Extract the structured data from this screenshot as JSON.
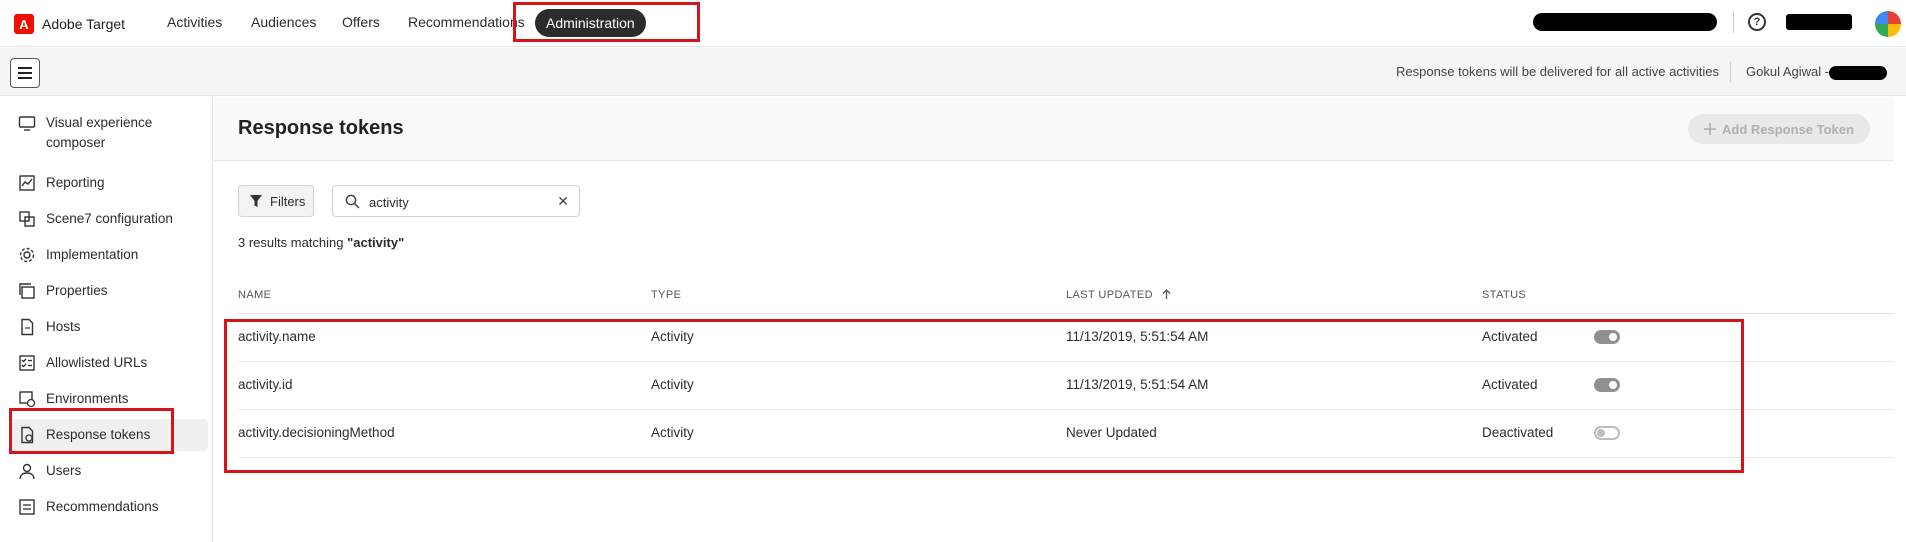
{
  "app": {
    "name": "Adobe Target",
    "logo_letter": "A",
    "brand_color": "#eb1000"
  },
  "nav": {
    "tabs": [
      {
        "label": "Activities"
      },
      {
        "label": "Audiences"
      },
      {
        "label": "Offers"
      },
      {
        "label": "Recommendations"
      },
      {
        "label": "Administration",
        "active": true
      }
    ]
  },
  "topbar": {
    "help_icon": "?"
  },
  "subbar": {
    "notice": "Response tokens will be delivered for all active activities",
    "user_name": "Gokul Agiwal -"
  },
  "sidebar": {
    "items": [
      {
        "label": "Visual experience composer",
        "icon": "monitor-icon"
      },
      {
        "label": "Reporting",
        "icon": "chart-icon"
      },
      {
        "label": "Scene7 configuration",
        "icon": "scene7-icon"
      },
      {
        "label": "Implementation",
        "icon": "gear-icon"
      },
      {
        "label": "Properties",
        "icon": "properties-icon"
      },
      {
        "label": "Hosts",
        "icon": "file-icon"
      },
      {
        "label": "Allowlisted URLs",
        "icon": "checklist-icon"
      },
      {
        "label": "Environments",
        "icon": "environment-icon"
      },
      {
        "label": "Response tokens",
        "icon": "token-icon",
        "selected": true
      },
      {
        "label": "Users",
        "icon": "user-icon"
      },
      {
        "label": "Recommendations",
        "icon": "recommendations-icon"
      }
    ]
  },
  "page": {
    "title": "Response tokens",
    "add_button": "Add Response Token",
    "filters_label": "Filters",
    "search_value": "activity",
    "results_prefix": "3 results matching ",
    "results_query": "\"activity\""
  },
  "table": {
    "columns": {
      "name": "NAME",
      "type": "TYPE",
      "last_updated": "LAST UPDATED",
      "status": "STATUS"
    },
    "rows": [
      {
        "name": "activity.name",
        "type": "Activity",
        "last_updated": "11/13/2019, 5:51:54 AM",
        "status": "Activated",
        "enabled": true
      },
      {
        "name": "activity.id",
        "type": "Activity",
        "last_updated": "11/13/2019, 5:51:54 AM",
        "status": "Activated",
        "enabled": true
      },
      {
        "name": "activity.decisioningMethod",
        "type": "Activity",
        "last_updated": "Never Updated",
        "status": "Deactivated",
        "enabled": false
      }
    ]
  },
  "colors": {
    "highlight": "#d7141a",
    "active_tab_bg": "#2c2c2c"
  }
}
